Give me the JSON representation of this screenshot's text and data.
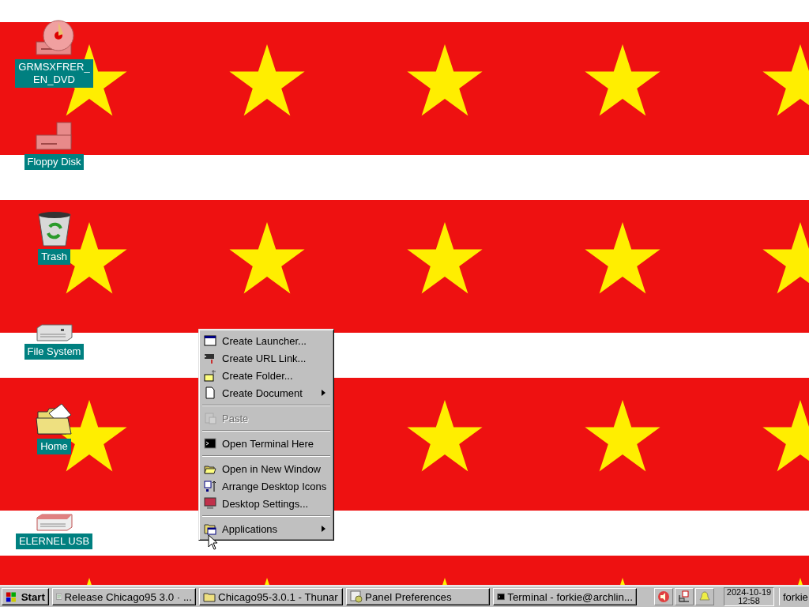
{
  "desktop_icons": [
    {
      "label": "GRMSXFRER_\nEN_DVD"
    },
    {
      "label": "Floppy Disk"
    },
    {
      "label": "Trash"
    },
    {
      "label": "File System"
    },
    {
      "label": "Home"
    },
    {
      "label": "ELERNEL USB"
    }
  ],
  "context_menu": {
    "items": [
      {
        "kind": "item",
        "label": "Create Launcher...",
        "disabled": false,
        "submenu": false
      },
      {
        "kind": "item",
        "label": "Create URL Link...",
        "disabled": false,
        "submenu": false
      },
      {
        "kind": "item",
        "label": "Create Folder...",
        "disabled": false,
        "submenu": false
      },
      {
        "kind": "item",
        "label": "Create Document",
        "disabled": false,
        "submenu": true
      },
      {
        "kind": "separator"
      },
      {
        "kind": "item",
        "label": "Paste",
        "disabled": true,
        "submenu": false
      },
      {
        "kind": "separator"
      },
      {
        "kind": "item",
        "label": "Open Terminal Here",
        "disabled": false,
        "submenu": false
      },
      {
        "kind": "separator"
      },
      {
        "kind": "item",
        "label": "Open in New Window",
        "disabled": false,
        "submenu": false
      },
      {
        "kind": "item",
        "label": "Arrange Desktop Icons",
        "disabled": false,
        "submenu": false
      },
      {
        "kind": "item",
        "label": "Desktop Settings...",
        "disabled": false,
        "submenu": false
      },
      {
        "kind": "separator"
      },
      {
        "kind": "item",
        "label": "Applications",
        "disabled": false,
        "submenu": true
      }
    ]
  },
  "taskbar": {
    "start": {
      "label": "Start"
    },
    "tasks": [
      {
        "label": "Release Chicago95 3.0 · ...",
        "selected": false
      },
      {
        "label": "Chicago95-3.0.1 - Thunar",
        "selected": false
      },
      {
        "label": "Panel Preferences",
        "selected": false
      },
      {
        "label": "Terminal - forkie@archlin...",
        "selected": false
      }
    ],
    "clock": {
      "date": "2024-10-19",
      "time": "12:58"
    },
    "user": "forkie"
  }
}
